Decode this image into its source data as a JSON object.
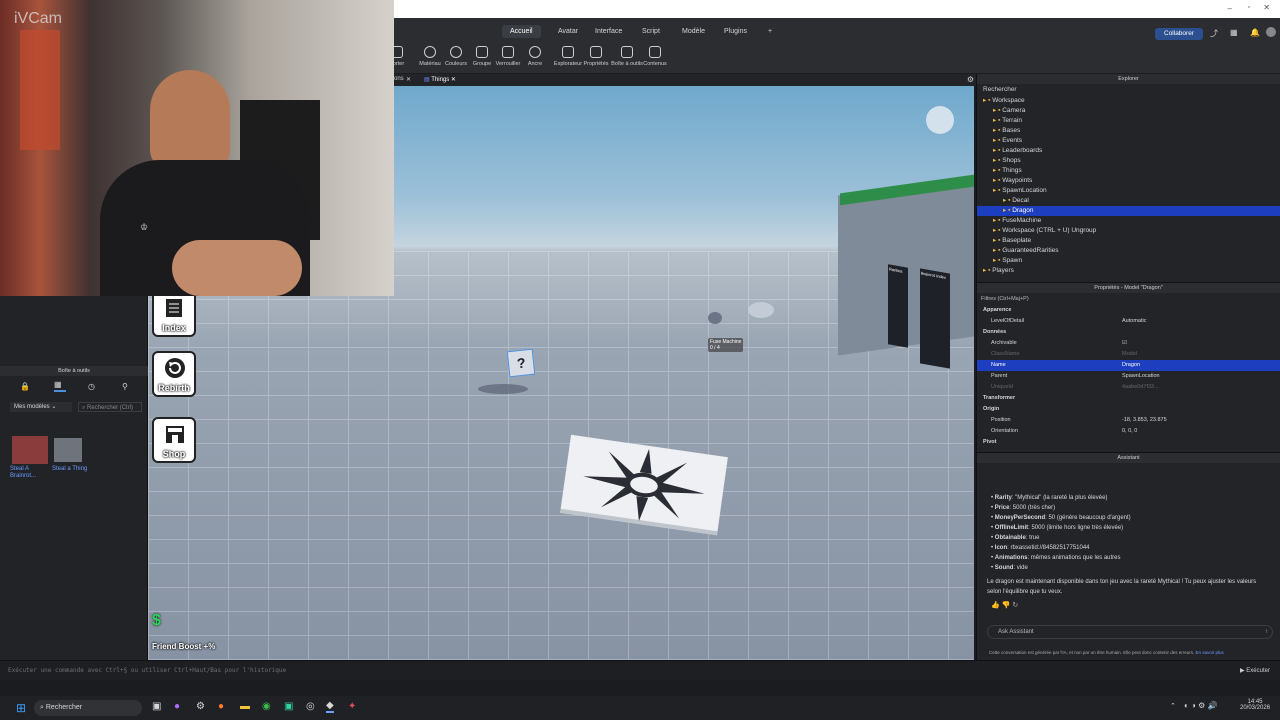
{
  "overlay": {
    "brand": "iVCam"
  },
  "ribbon": {
    "tabs": [
      "Accueil",
      "Avatar",
      "Interface",
      "Script",
      "Modèle",
      "Plugins"
    ],
    "active_tab": "Accueil",
    "tools": [
      "porter",
      "Matériau",
      "Couleurs",
      "Groupe",
      "Verrouiller",
      "Ancre",
      "Explorateur",
      "Propriétés",
      "Boîte à outils",
      "Contenus"
    ],
    "collaborate": "Collaborer"
  },
  "doc_tabs": {
    "left_fragment": "ons",
    "current": "Things"
  },
  "hud": {
    "index": "Index",
    "rebirth": "Rebirth",
    "shop": "Shop",
    "friend_boost": "Friend Boost +%",
    "sign_left": "Fuse Machine",
    "sign_top": "Fuse Machine",
    "sign_top2": "0 / 4",
    "board1": "Rarities",
    "board2": "Brainrot Index"
  },
  "toolbox": {
    "title": "Boîte à outils",
    "filter": "Mes modèles",
    "search_placeholder": "Rechercher (Ctrl)",
    "items": [
      {
        "label": "Steal A Brainrot..."
      },
      {
        "label": "Steal a Thing"
      }
    ]
  },
  "explorer": {
    "title": "Explorer",
    "search_placeholder": "Rechercher",
    "nodes": [
      {
        "label": "Workspace",
        "depth": 0
      },
      {
        "label": "Camera",
        "depth": 1
      },
      {
        "label": "Terrain",
        "depth": 1
      },
      {
        "label": "Bases",
        "depth": 1
      },
      {
        "label": "Events",
        "depth": 1
      },
      {
        "label": "Leaderboards",
        "depth": 1
      },
      {
        "label": "Shops",
        "depth": 1
      },
      {
        "label": "Things",
        "depth": 1
      },
      {
        "label": "Waypoints",
        "depth": 1
      },
      {
        "label": "SpawnLocation",
        "depth": 1
      },
      {
        "label": "Decal",
        "depth": 2
      },
      {
        "label": "Dragon",
        "depth": 2,
        "selected": true
      },
      {
        "label": "FuseMachine",
        "depth": 1
      },
      {
        "label": "Workspace (CTRL + U) Ungroup",
        "depth": 1
      },
      {
        "label": "Baseplate",
        "depth": 1
      },
      {
        "label": "GuaranteedRarities",
        "depth": 1
      },
      {
        "label": "Spawn",
        "depth": 1
      },
      {
        "label": "Players",
        "depth": 0
      }
    ]
  },
  "properties": {
    "title": "Propriétés - Model \"Dragon\"",
    "filter": "Filtres (Ctrl+Maj+P)",
    "rows": [
      {
        "type": "sec",
        "k": "Apparence"
      },
      {
        "k": "LevelOfDetail",
        "v": "Automatic"
      },
      {
        "type": "sec",
        "k": "Données"
      },
      {
        "k": "Archivable",
        "v": "☑"
      },
      {
        "k": "ClassName",
        "v": "Model",
        "dim": true
      },
      {
        "k": "Name",
        "v": "Dragon",
        "selected": true
      },
      {
        "k": "Parent",
        "v": "SpawnLocation"
      },
      {
        "k": "UniqueId",
        "v": "4aabe0d7f33...",
        "dim": true
      },
      {
        "type": "sec",
        "k": "Transformer"
      },
      {
        "type": "sec",
        "k": "Origin"
      },
      {
        "k": "Position",
        "v": "-18, 3.853, 23.875"
      },
      {
        "k": "Orientation",
        "v": "0, 0, 0"
      },
      {
        "type": "sec",
        "k": "Pivot"
      }
    ]
  },
  "assistant": {
    "title": "Assistant",
    "bullets": [
      {
        "key": "Rarity",
        "text": ": \"Mythical\" (la rareté la plus élevée)"
      },
      {
        "key": "Price",
        "text": ": 5000 (très cher)"
      },
      {
        "key": "MoneyPerSecond",
        "text": ": 50 (génère beaucoup d'argent)"
      },
      {
        "key": "OfflineLimit",
        "text": ": 5000 (limite hors ligne très élevée)"
      },
      {
        "key": "Obtainable",
        "text": ": true"
      },
      {
        "key": "Icon",
        "text": ": rbxassetid://84582517751044"
      },
      {
        "key": "Animations",
        "text": ": mêmes animations que les autres"
      },
      {
        "key": "Sound",
        "text": ": vide"
      }
    ],
    "message": "Le dragon est maintenant disponible dans ton jeu avec la rareté Mythical ! Tu peux ajuster les valeurs selon l'équilibre que tu veux.",
    "input_placeholder": "Ask Assistant",
    "disclaimer": "Cette conversation est générée par l'IA, et non par un être humain. Elle peut donc contenir des erreurs.",
    "disclaimer_link": "En savoir plus"
  },
  "command_bar": {
    "placeholder": "Exécuter une commande avec Ctrl+§ ou utiliser Ctrl+Haut/Bas pour l'historique",
    "run": "Exécuter"
  },
  "taskbar": {
    "search": "Rechercher",
    "time": "14:45",
    "date": "20/03/2026"
  }
}
